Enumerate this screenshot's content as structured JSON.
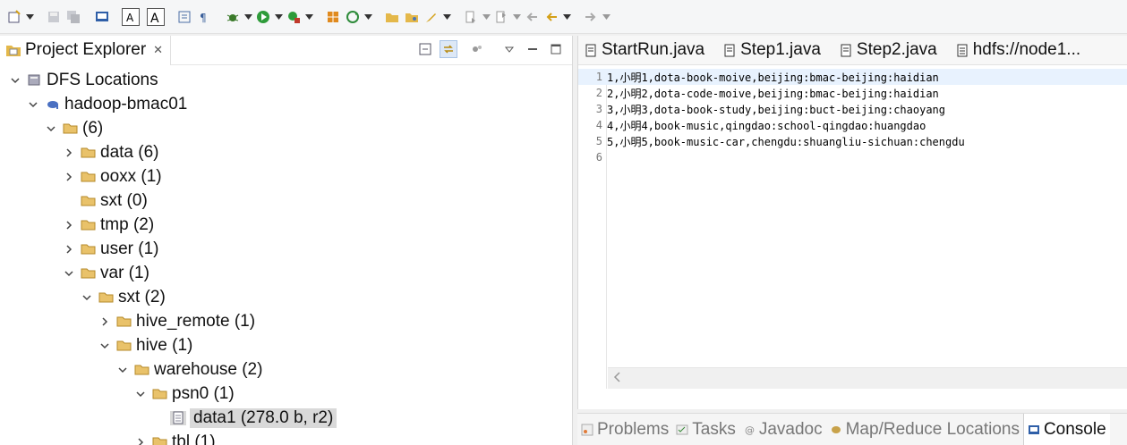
{
  "toolbar": {
    "icons": [
      "new-icon",
      "save-icon",
      "save-all-icon",
      "terminal-icon",
      "font-larger-icon",
      "font-smaller-icon",
      "block-select-icon",
      "show-whitespace-icon",
      "debug-icon",
      "run-icon",
      "run-external-icon",
      "new-package-icon",
      "refresh-icon",
      "open-folder-icon",
      "open-type-icon",
      "edit-icon",
      "next-annotation-icon",
      "prev-annotation-icon",
      "back-icon",
      "forward-icon"
    ]
  },
  "project_explorer": {
    "title": "Project Explorer",
    "tree": [
      {
        "label": "DFS Locations"
      },
      {
        "label": "hadoop-bmac01"
      },
      {
        "label": " (6)"
      },
      {
        "label": "data (6)"
      },
      {
        "label": "ooxx (1)"
      },
      {
        "label": "sxt (0)"
      },
      {
        "label": "tmp (2)"
      },
      {
        "label": "user (1)"
      },
      {
        "label": "var (1)"
      },
      {
        "label": "sxt (2)"
      },
      {
        "label": "hive_remote (1)"
      },
      {
        "label": "hive (1)"
      },
      {
        "label": "warehouse (2)"
      },
      {
        "label": "psn0 (1)"
      },
      {
        "label": "data1 (278.0 b, r2)"
      },
      {
        "label": "tbl (1)"
      }
    ]
  },
  "editor": {
    "tabs": [
      {
        "label": "StartRun.java"
      },
      {
        "label": "Step1.java"
      },
      {
        "label": "Step2.java"
      },
      {
        "label": "hdfs://node1..."
      }
    ],
    "lines": [
      {
        "num": "1",
        "text": "1,小明1,dota-book-moive,beijing:bmac-beijing:haidian"
      },
      {
        "num": "2",
        "text": "2,小明2,dota-code-moive,beijing:bmac-beijing:haidian"
      },
      {
        "num": "3",
        "text": "3,小明3,dota-book-study,beijing:buct-beijing:chaoyang"
      },
      {
        "num": "4",
        "text": "4,小明4,book-music,qingdao:school-qingdao:huangdao"
      },
      {
        "num": "5",
        "text": "5,小明5,book-music-car,chengdu:shuangliu-sichuan:chengdu"
      },
      {
        "num": "6",
        "text": ""
      }
    ]
  },
  "bottom_tabs": [
    {
      "label": "Problems"
    },
    {
      "label": "Tasks"
    },
    {
      "label": "Javadoc"
    },
    {
      "label": "Map/Reduce Locations"
    },
    {
      "label": "Console"
    }
  ]
}
